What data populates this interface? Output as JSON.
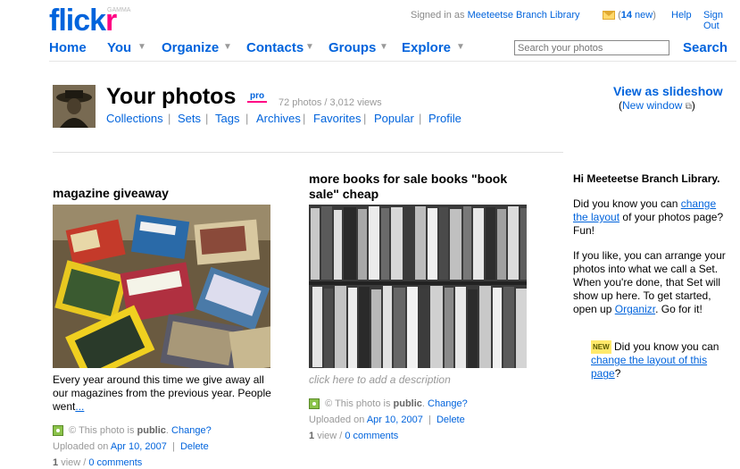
{
  "header": {
    "logo_main": "flick",
    "logo_r": "r",
    "logo_gamma": "GAMMA",
    "signed_in_prefix": "Signed in as",
    "signed_in_user": "Meeteetse Branch Library",
    "mail_count": "14",
    "mail_suffix": "new",
    "help": "Help",
    "signout": "Sign Out"
  },
  "nav": {
    "home": "Home",
    "you": "You",
    "organize": "Organize",
    "contacts": "Contacts",
    "groups": "Groups",
    "explore": "Explore"
  },
  "search": {
    "placeholder": "Search your photos",
    "button": "Search"
  },
  "profile": {
    "title": "Your photos",
    "pro": "pro",
    "stats": "72 photos / 3,012 views",
    "subnav": [
      "Collections",
      "Sets",
      "Tags",
      "Archives",
      "Favorites",
      "Popular",
      "Profile"
    ],
    "slideshow": "View as slideshow",
    "new_window": "New window"
  },
  "photos": [
    {
      "title": "magazine giveaway",
      "description": "Every year around this time we give away all our magazines from the previous year. People went",
      "desc_more": "...",
      "public_prefix": "© This photo is",
      "public_word": "public",
      "change": "Change?",
      "uploaded_prefix": "Uploaded on",
      "uploaded_date": "Apr 10, 2007",
      "delete": "Delete",
      "views_count": "1",
      "views_word": "view",
      "comments": "0 comments"
    },
    {
      "title": "more books for sale books \"book sale\" cheap",
      "description": "click here to add a description",
      "public_prefix": "© This photo is",
      "public_word": "public",
      "change": "Change?",
      "uploaded_prefix": "Uploaded on",
      "uploaded_date": "Apr 10, 2007",
      "delete": "Delete",
      "views_count": "1",
      "views_word": "view",
      "comments": "0 comments"
    }
  ],
  "sidebar": {
    "greeting": "Hi Meeteetse Branch Library.",
    "p1_pre": "Did you know you can",
    "p1_link": "change the layout",
    "p1_post": "of your photos page? Fun!",
    "p2_pre": "If you like, you can arrange your photos into what we call a Set. When you're done, that Set will show up here. To get started, open up",
    "p2_link": "Organizr",
    "p2_post": ". Go for it!",
    "new_badge": "NEW",
    "p3_pre": "Did you know you can",
    "p3_link": "change the layout of this page",
    "p3_post": "?"
  },
  "colors": {
    "link_blue": "#0063dc",
    "brand_pink": "#ff0084"
  }
}
